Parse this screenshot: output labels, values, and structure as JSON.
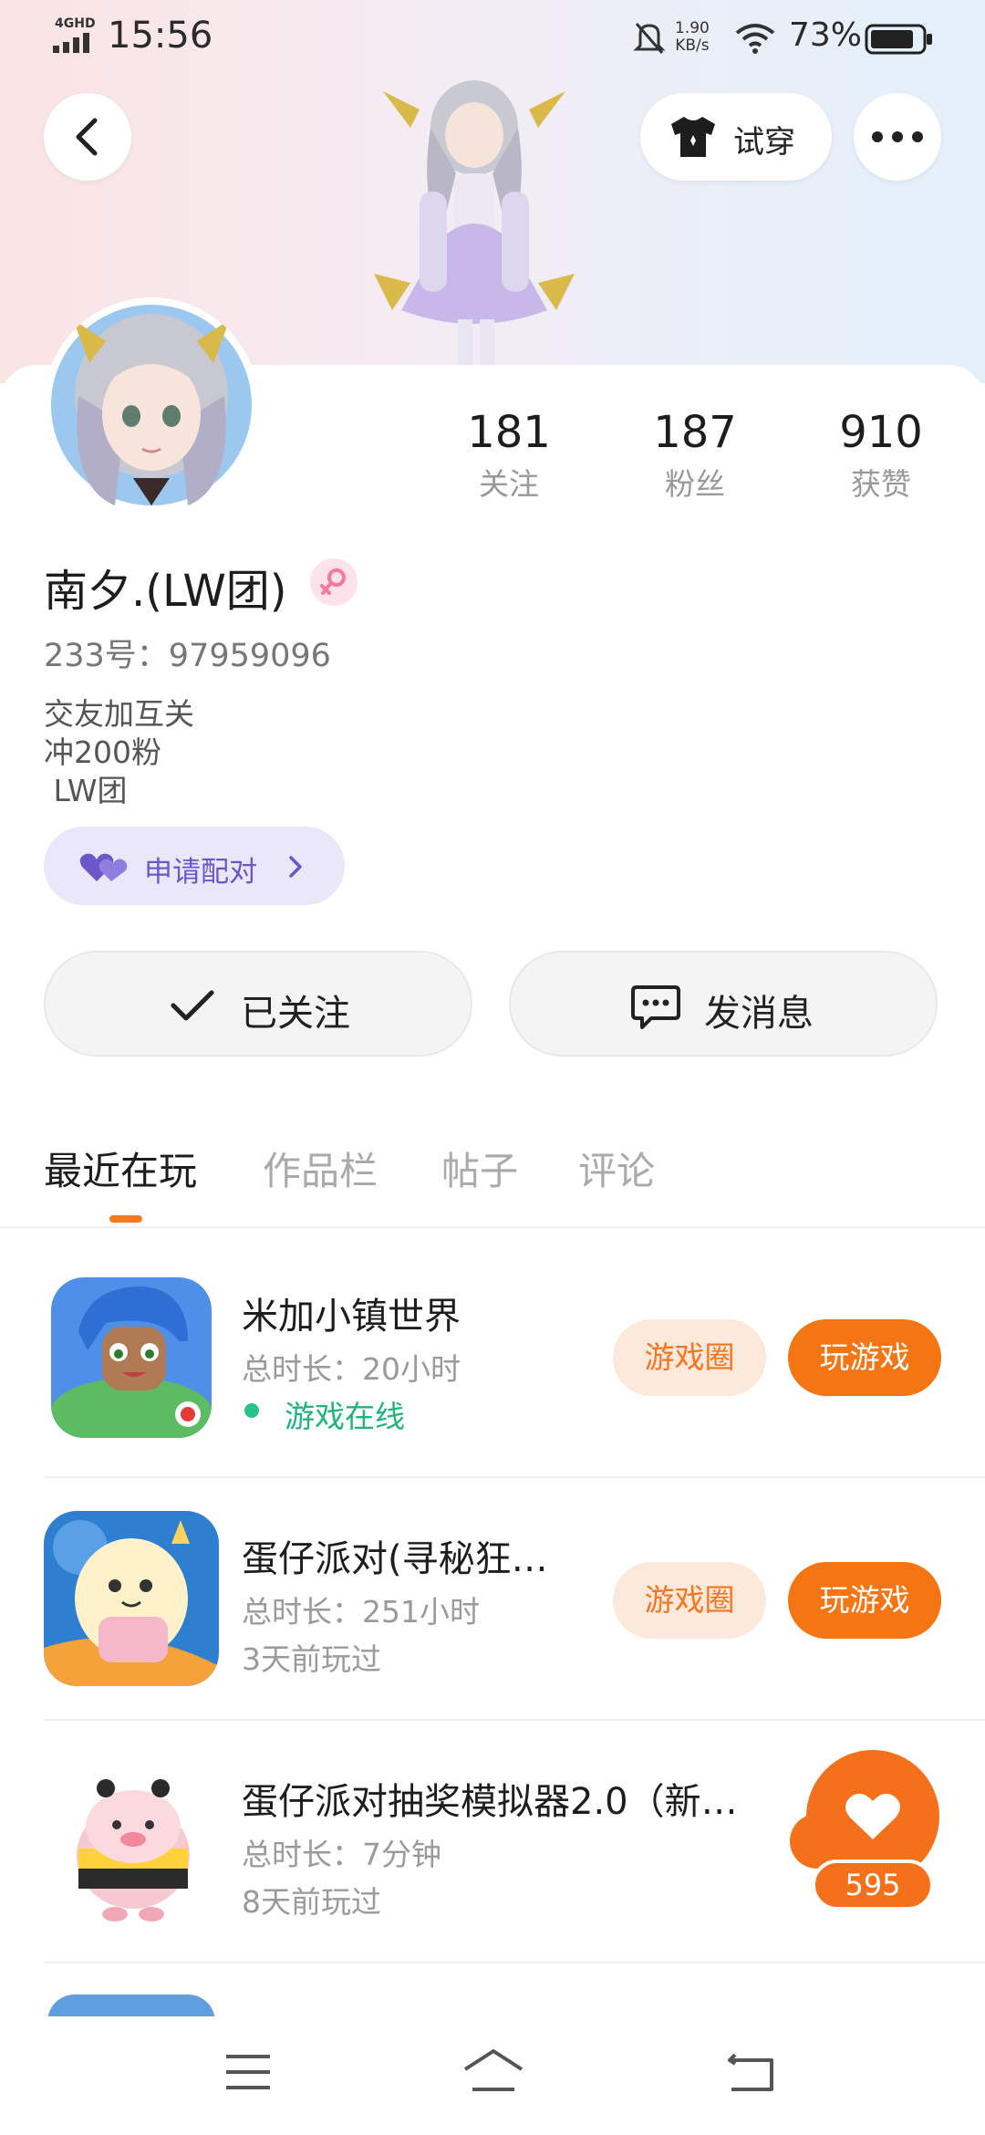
{
  "status_bar": {
    "network": "4GHD",
    "time": "15:56",
    "speed_value": "1.90",
    "speed_unit": "KB/s",
    "battery": "73%"
  },
  "header": {
    "try_on_label": "试穿"
  },
  "profile": {
    "stats": [
      {
        "value": "181",
        "label": "关注"
      },
      {
        "value": "187",
        "label": "粉丝"
      },
      {
        "value": "910",
        "label": "获赞"
      }
    ],
    "name": "南夕.(LW团)",
    "uid": "233号：97959096",
    "bio_lines": [
      "交友加互关",
      "冲200粉",
      " LW团"
    ],
    "pair_label": "申请配对",
    "follow_label": "已关注",
    "message_label": "发消息"
  },
  "tabs": [
    {
      "label": "最近在玩",
      "active": true
    },
    {
      "label": "作品栏",
      "active": false
    },
    {
      "label": "帖子",
      "active": false
    },
    {
      "label": "评论",
      "active": false
    }
  ],
  "games": [
    {
      "title": "米加小镇世界",
      "duration": "总时长：20小时",
      "status": "游戏在线",
      "circle_label": "游戏圈",
      "play_label": "玩游戏"
    },
    {
      "title": "蛋仔派对(寻秘狂…",
      "duration": "总时长：251小时",
      "status": "3天前玩过",
      "circle_label": "游戏圈",
      "play_label": "玩游戏"
    },
    {
      "title": "蛋仔派对抽奖模拟器2.0（新…",
      "duration": "总时长：7分钟",
      "status": "8天前玩过"
    }
  ],
  "floating_like": {
    "count": "595"
  },
  "colors": {
    "accent": "#f57512",
    "online": "#1fb57a",
    "pair": "#6b57c9"
  }
}
